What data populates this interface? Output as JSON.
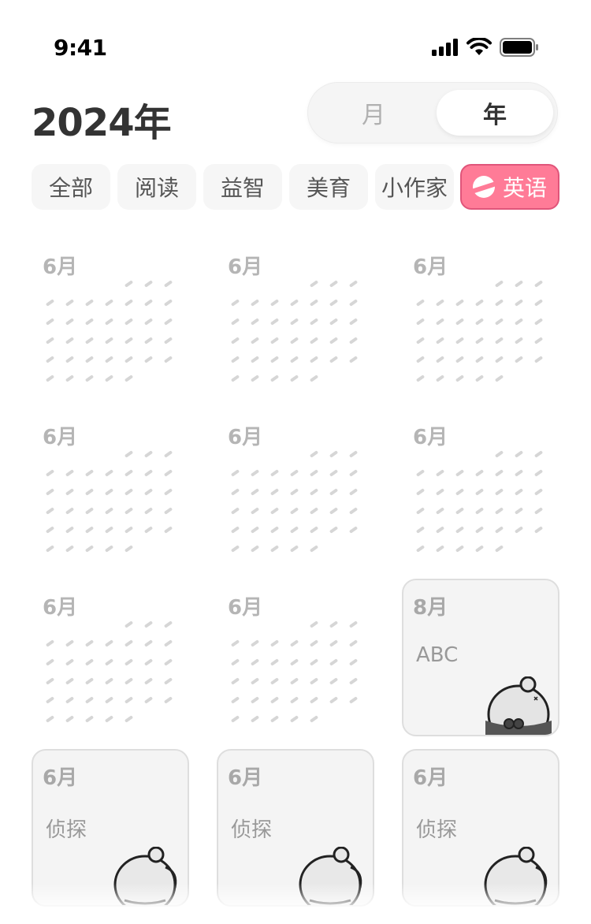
{
  "status_bar": {
    "time": "9:41"
  },
  "header": {
    "title": "2024年",
    "view_toggle": {
      "month": "月",
      "year": "年",
      "selected": "年"
    }
  },
  "categories": [
    {
      "label": "全部",
      "active": false
    },
    {
      "label": "阅读",
      "active": false
    },
    {
      "label": "益智",
      "active": false
    },
    {
      "label": "美育",
      "active": false
    },
    {
      "label": "小作家",
      "active": false
    },
    {
      "label": "英语",
      "active": true
    }
  ],
  "months": [
    {
      "month": "6月",
      "type": "empty"
    },
    {
      "month": "6月",
      "type": "empty"
    },
    {
      "month": "6月",
      "type": "empty"
    },
    {
      "month": "6月",
      "type": "empty"
    },
    {
      "month": "6月",
      "type": "empty"
    },
    {
      "month": "6月",
      "type": "empty"
    },
    {
      "month": "6月",
      "type": "empty"
    },
    {
      "month": "6月",
      "type": "empty"
    },
    {
      "month": "8月",
      "type": "card",
      "label": "ABC"
    },
    {
      "month": "6月",
      "type": "card",
      "label": "侦探"
    },
    {
      "month": "6月",
      "type": "card",
      "label": "侦探"
    },
    {
      "month": "6月",
      "type": "card",
      "label": "侦探"
    }
  ],
  "colors": {
    "accent": "#ff7b97",
    "accent_border": "#e0557a",
    "muted": "#b5b5b5"
  }
}
